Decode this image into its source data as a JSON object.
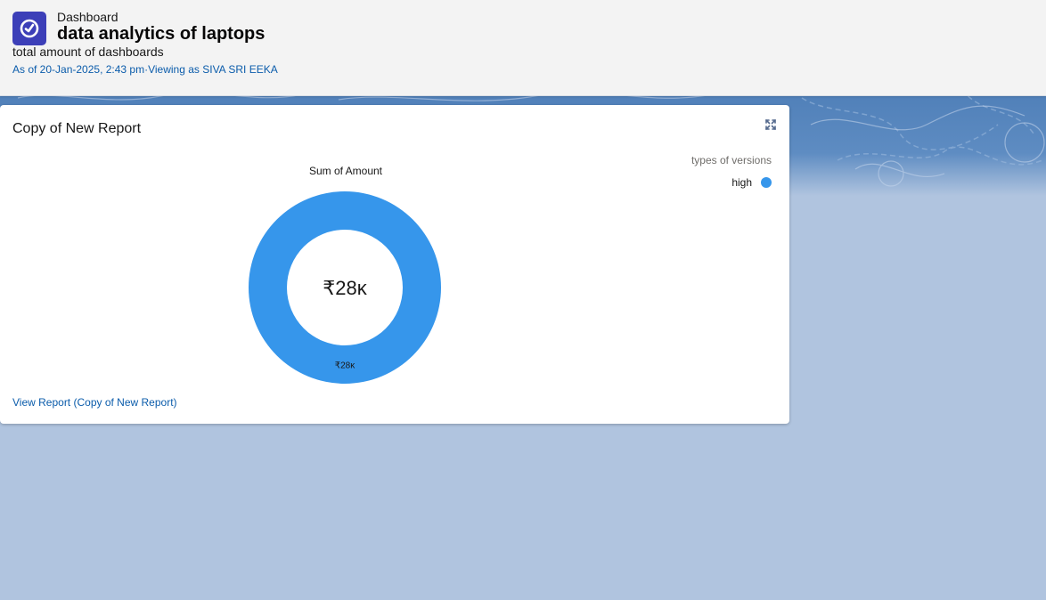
{
  "header": {
    "eyebrow": "Dashboard",
    "title": "data analytics of laptops",
    "subtitle": "total amount of dashboards",
    "meta": "As of 20-Jan-2025, 2:43 pm·Viewing as SIVA SRI EEKA",
    "icon": "dashboard-gauge-icon"
  },
  "card": {
    "title": "Copy of New Report",
    "expand_icon": "expand-icon",
    "view_link": "View Report (Copy of New Report)"
  },
  "colors": {
    "accent": "#3c3fb8",
    "series": "#3696eb",
    "link": "#0b5cab",
    "background": "#b0c4df"
  },
  "chart_data": {
    "type": "pie",
    "title": "Sum of Amount",
    "center_label": "₹28ĸ",
    "legend_title": "types of versions",
    "legend_position": "top-right",
    "series": [
      {
        "name": "high",
        "value": 28000,
        "label": "₹28ĸ",
        "color": "#3696eb"
      }
    ]
  }
}
